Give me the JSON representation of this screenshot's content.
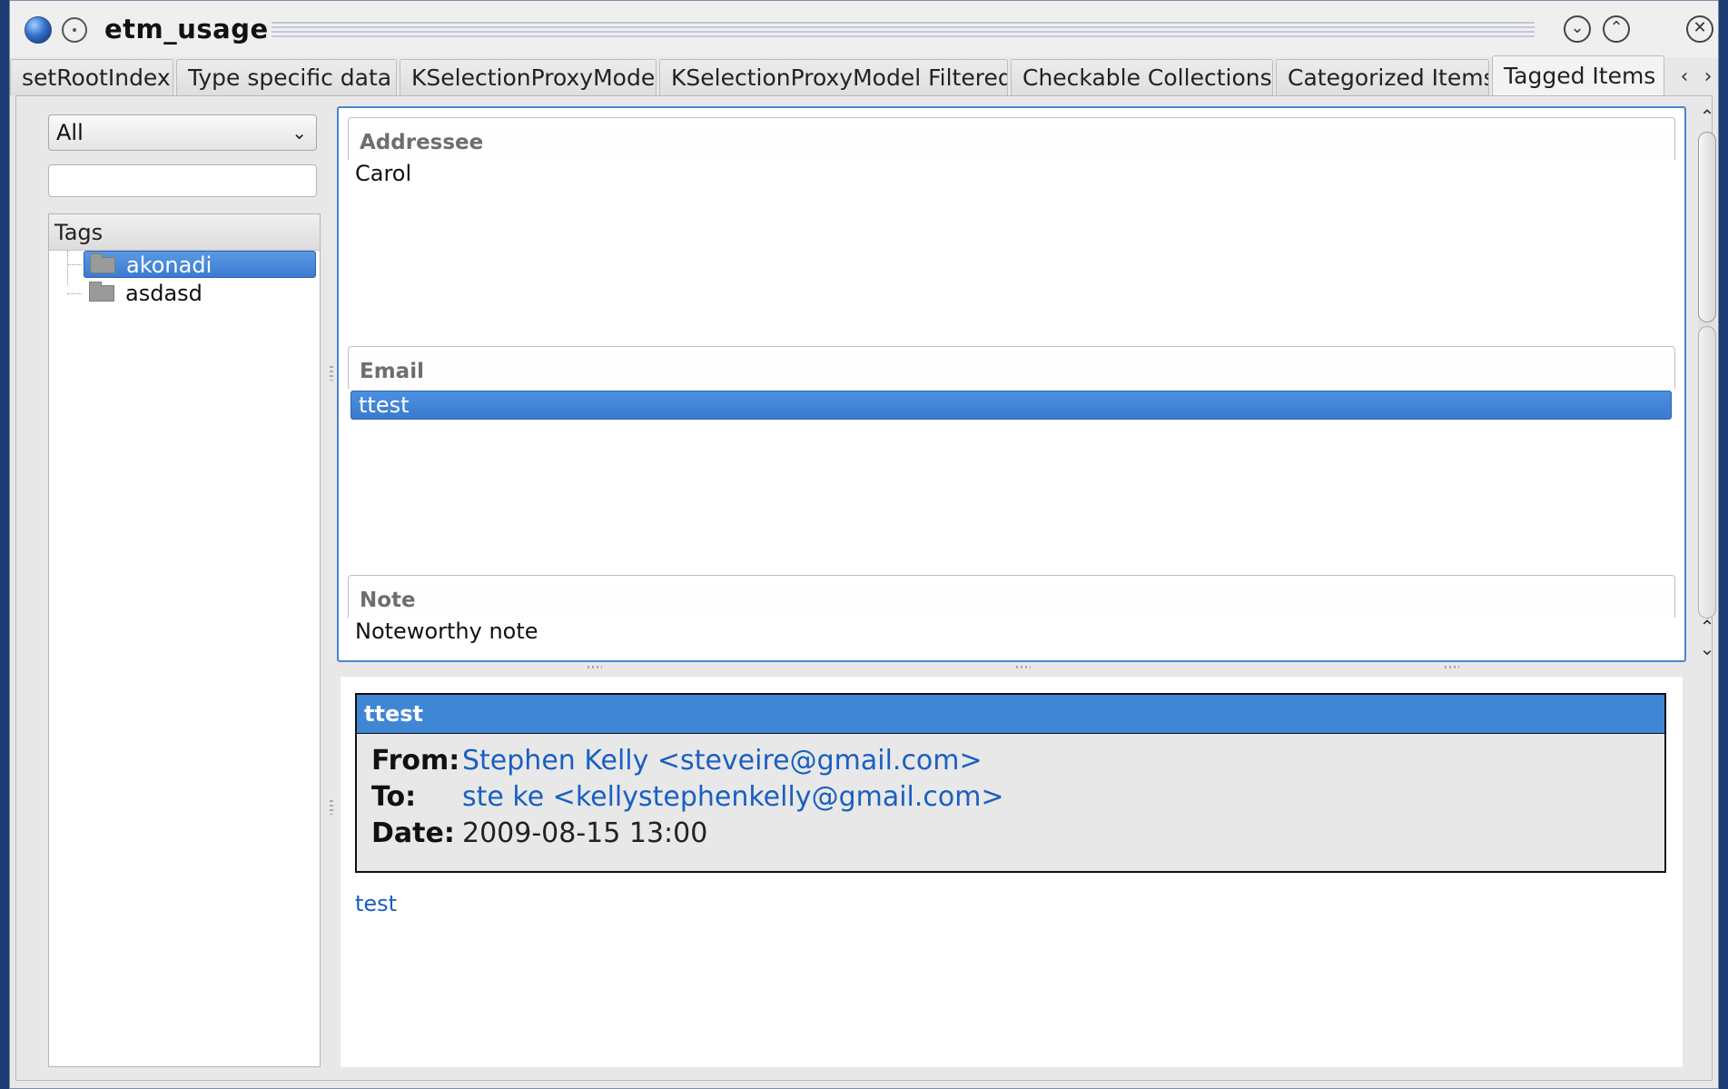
{
  "window": {
    "title": "etm_usage",
    "minimize_glyph": "⌄",
    "maximize_glyph": "⌃",
    "close_glyph": "✕"
  },
  "tabs": [
    {
      "label": "setRootIndex",
      "active": false
    },
    {
      "label": "Type specific data",
      "active": false
    },
    {
      "label": "KSelectionProxyModel",
      "active": false
    },
    {
      "label": "KSelectionProxyModel Filtered",
      "active": false
    },
    {
      "label": "Checkable Collections",
      "active": false
    },
    {
      "label": "Categorized Items",
      "active": false
    },
    {
      "label": "Tagged Items",
      "active": true
    }
  ],
  "tab_scroll": {
    "left": "‹",
    "right": "›"
  },
  "filter": {
    "combo_value": "All",
    "search_value": "",
    "search_placeholder": ""
  },
  "tags": {
    "header": "Tags",
    "items": [
      {
        "label": "akonadi",
        "selected": true
      },
      {
        "label": "asdasd",
        "selected": false
      }
    ]
  },
  "categories": [
    {
      "heading": "Addressee",
      "items": [
        {
          "label": "Carol",
          "selected": false
        }
      ]
    },
    {
      "heading": "Email",
      "items": [
        {
          "label": "ttest",
          "selected": true
        }
      ]
    },
    {
      "heading": "Note",
      "items": [
        {
          "label": "Noteworthy note",
          "selected": false
        }
      ]
    }
  ],
  "message": {
    "subject": "ttest",
    "from_label": "From:",
    "from_value": "Stephen Kelly <steveire@gmail.com>",
    "to_label": "To:",
    "to_value": "ste ke <kellystephenkelly@gmail.com>",
    "date_label": "Date:",
    "date_value": "2009-08-15 13:00",
    "body": "test"
  },
  "colors": {
    "selection": "#3a7bd0",
    "link": "#1a5fc2",
    "subject_bar": "#3f87d4"
  }
}
